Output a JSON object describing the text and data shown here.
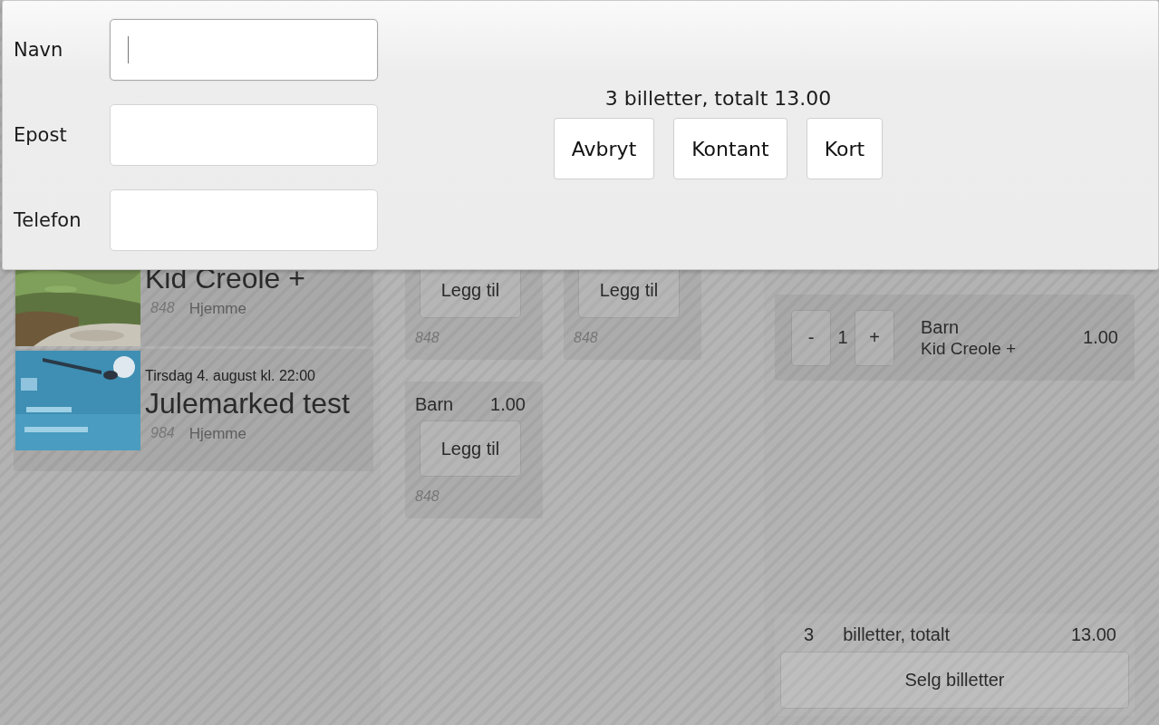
{
  "dialog": {
    "fields": [
      {
        "label": "Navn",
        "focused": true
      },
      {
        "label": "Epost",
        "focused": false
      },
      {
        "label": "Telefon",
        "focused": false
      }
    ],
    "summary": "3 billetter, totalt 13.00",
    "buttons": [
      "Avbryt",
      "Kontant",
      "Kort"
    ]
  },
  "events": [
    {
      "title": "Kid Creole +",
      "number": "848",
      "venue": "Hjemme"
    },
    {
      "date": "Tirsdag 4. august kl. 22:00",
      "title": "Julemarked test",
      "number": "984",
      "venue": "Hjemme"
    }
  ],
  "tickets": [
    {
      "button": "Legg til",
      "number": "848"
    },
    {
      "button": "Legg til",
      "number": "848"
    },
    {
      "name": "Barn",
      "price": "1.00",
      "button": "Legg til",
      "number": "848"
    }
  ],
  "cart": {
    "items": [
      {
        "minus": "-",
        "quantity": "1",
        "plus": "+",
        "name": "Barn",
        "event": "Kid Creole +",
        "price": "1.00"
      }
    ],
    "total_count": "3",
    "total_label": "billetter, totalt",
    "total": "13.00",
    "sell_button": "Selg billetter"
  }
}
